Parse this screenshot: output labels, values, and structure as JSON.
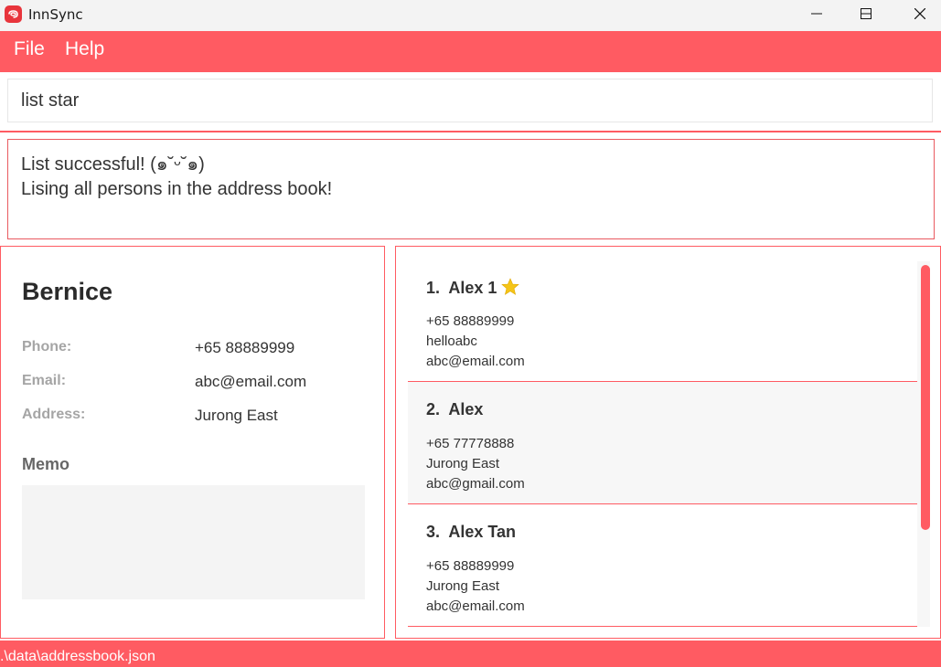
{
  "window": {
    "title": "InnSync"
  },
  "menu": {
    "items": [
      "File",
      "Help"
    ]
  },
  "command": {
    "value": "list star"
  },
  "result": {
    "line1": "List successful! (๑˘ᵕ˘๑)",
    "line2": "Lising all persons in the address book!"
  },
  "detail": {
    "name": "Bernice",
    "phone_label": "Phone:",
    "phone": "+65 88889999",
    "email_label": "Email:",
    "email": "abc@email.com",
    "address_label": "Address:",
    "address": "Jurong East",
    "memo_label": "Memo"
  },
  "persons": [
    {
      "index": "1.",
      "name": "Alex 1",
      "starred": true,
      "lines": [
        "+65 88889999",
        "helloabc",
        "abc@email.com"
      ]
    },
    {
      "index": "2.",
      "name": "Alex",
      "starred": false,
      "lines": [
        "+65 77778888",
        "Jurong East",
        "abc@gmail.com"
      ]
    },
    {
      "index": "3.",
      "name": "Alex Tan",
      "starred": false,
      "lines": [
        "+65 88889999",
        "Jurong East",
        "abc@email.com"
      ]
    }
  ],
  "status": {
    "path": ".\\data\\addressbook.json"
  },
  "colors": {
    "accent": "#ff5b62",
    "star": "#f5c518",
    "icon_bg": "#e8353c"
  },
  "icons": {
    "star": "star-icon"
  }
}
